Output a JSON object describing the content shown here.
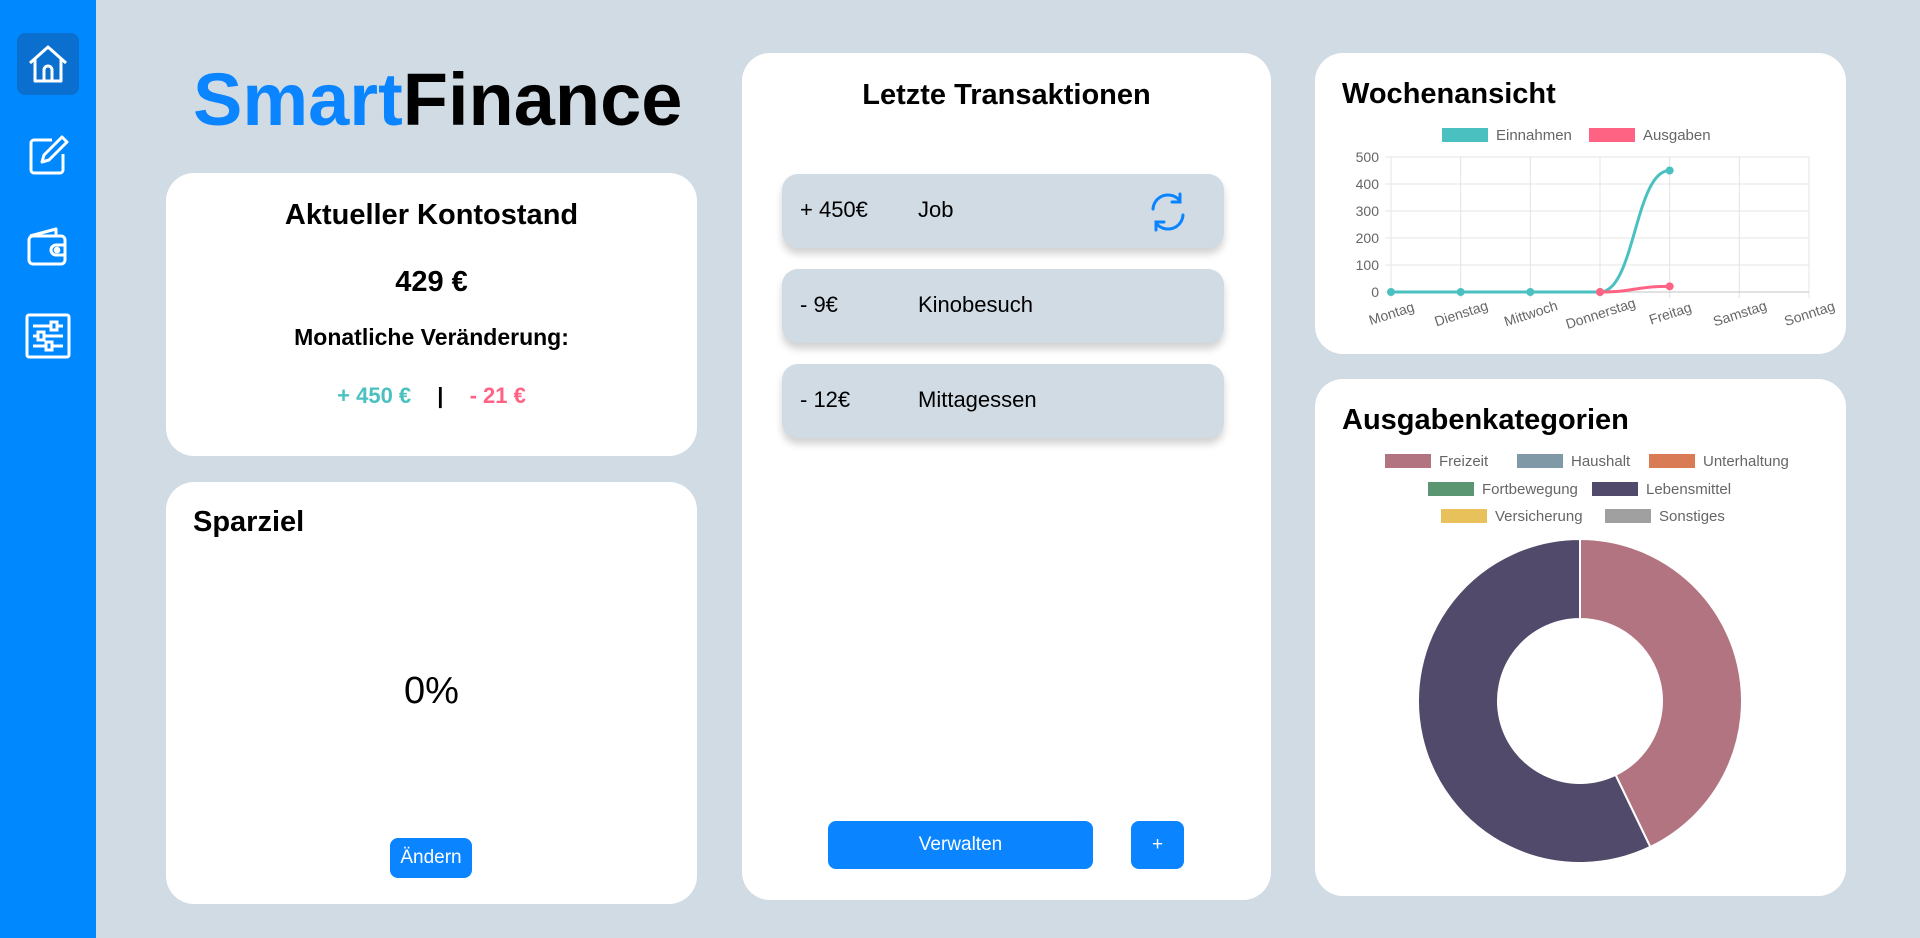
{
  "app": {
    "logo_part1": "Smart",
    "logo_part2": "Finance"
  },
  "sidebar": {
    "items": [
      {
        "name": "home",
        "icon": "home-icon",
        "active": true
      },
      {
        "name": "edit",
        "icon": "edit-icon"
      },
      {
        "name": "wallet",
        "icon": "wallet-icon"
      },
      {
        "name": "settings",
        "icon": "sliders-icon"
      }
    ]
  },
  "balance": {
    "title": "Aktueller Kontostand",
    "amount": "429 €",
    "monthly_label": "Monatliche Veränderung:",
    "income": "+ 450 €",
    "separator": "|",
    "expense": "- 21 €"
  },
  "savings": {
    "title": "Sparziel",
    "percent": "0%",
    "change_button": "Ändern"
  },
  "transactions": {
    "title": "Letzte Transaktionen",
    "items": [
      {
        "amount": "+ 450€",
        "name": "Job",
        "recurring": true
      },
      {
        "amount": "- 9€",
        "name": "Kinobesuch"
      },
      {
        "amount": "- 12€",
        "name": "Mittagessen"
      }
    ],
    "manage_button": "Verwalten",
    "add_button": "+"
  },
  "colors": {
    "accent": "#0a84ff",
    "income": "#4bc0c0",
    "expense": "#ff6384",
    "background": "#d0dbe4"
  },
  "chart_data": [
    {
      "type": "line",
      "title": "Wochenansicht",
      "x": [
        "Montag",
        "Dienstag",
        "Mittwoch",
        "Donnerstag",
        "Freitag",
        "Samstag",
        "Sonntag"
      ],
      "series": [
        {
          "name": "Einnahmen",
          "color": "#4bc0c0",
          "values": [
            0,
            0,
            0,
            0,
            450,
            null,
            null
          ]
        },
        {
          "name": "Ausgaben",
          "color": "#ff6384",
          "values": [
            null,
            null,
            null,
            0,
            21,
            null,
            null
          ]
        }
      ],
      "yticks": [
        "0",
        "100",
        "200",
        "300",
        "400",
        "500"
      ],
      "ylim": [
        0,
        500
      ],
      "legend": "top",
      "grid": true
    },
    {
      "type": "pie",
      "title": "Ausgabenkategorien",
      "categories": [
        "Freizeit",
        "Haushalt",
        "Unterhaltung",
        "Fortbewegung",
        "Lebensmittel",
        "Versicherung",
        "Sonstiges"
      ],
      "colors": [
        "#b37482",
        "#7f99a6",
        "#d97b55",
        "#5a9672",
        "#524a6a",
        "#e9c15a",
        "#a0a0a0"
      ],
      "values": [
        9,
        0,
        0,
        0,
        12,
        0,
        0
      ],
      "legend": "top"
    }
  ]
}
